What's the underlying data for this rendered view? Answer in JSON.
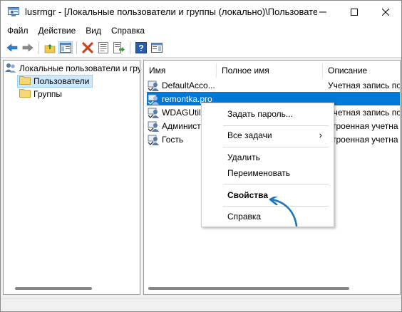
{
  "window": {
    "title": "lusrmgr - [Локальные пользователи и группы (локально)\\Пользовате..."
  },
  "menu": [
    "Файл",
    "Действие",
    "Вид",
    "Справка"
  ],
  "toolbar": {
    "icons": [
      "back-arrow",
      "forward-arrow",
      "up-folder",
      "show-hide-tree",
      "delete",
      "properties",
      "export-list",
      "help",
      "show-hide-action-pane"
    ]
  },
  "tree": {
    "root": "Локальные пользователи и гру",
    "children": [
      "Пользователи",
      "Группы"
    ],
    "selected": "Пользователи"
  },
  "list": {
    "columns": [
      "Имя",
      "Полное имя",
      "Описание"
    ],
    "rows": [
      {
        "name": "DefaultAcco...",
        "full_name": "",
        "description": "Учетная запись по",
        "selected": false
      },
      {
        "name": "remontka.pro",
        "full_name": "",
        "description": "",
        "selected": true
      },
      {
        "name": "WDAGUtili",
        "full_name": "",
        "description": "Учетная запись по",
        "selected": false
      },
      {
        "name": "Админист",
        "full_name": "",
        "description": "строенная учетна",
        "selected": false
      },
      {
        "name": "Гость",
        "full_name": "",
        "description": "строенная учетна",
        "selected": false
      }
    ]
  },
  "context_menu": {
    "set_password": "Задать пароль...",
    "all_tasks": "Все задачи",
    "delete": "Удалить",
    "rename": "Переименовать",
    "properties": "Свойства",
    "help": "Справка"
  },
  "colors": {
    "selection_blue": "#0078d7",
    "tree_selection": "#cce8ff",
    "annotation_arrow": "#1a75bc"
  }
}
